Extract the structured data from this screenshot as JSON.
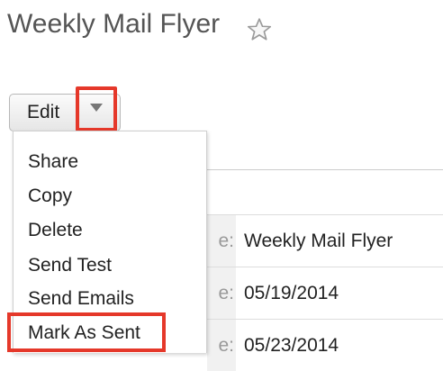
{
  "page": {
    "title": "Weekly Mail Flyer",
    "favorite_icon": "star-outline-icon"
  },
  "actions": {
    "edit_label": "Edit",
    "dropdown_icon": "caret-down-icon",
    "menu_items": [
      "Share",
      "Copy",
      "Delete",
      "Send Test",
      "Send Emails",
      "Mark As Sent"
    ]
  },
  "details": {
    "rows": [
      {
        "label_fragment": "e:",
        "value": "Weekly Mail Flyer"
      },
      {
        "label_fragment": "e:",
        "value": "05/19/2014"
      },
      {
        "label_fragment": "e:",
        "value": "05/23/2014"
      }
    ]
  },
  "colors": {
    "highlight": "#e5382a",
    "title_text": "#555555"
  }
}
